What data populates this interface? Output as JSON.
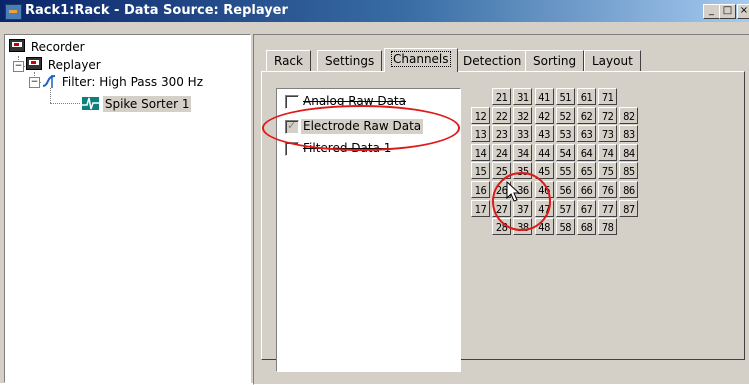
{
  "window": {
    "title": "Rack1:Rack - Data Source: Replayer",
    "buttons": [
      "minimize",
      "maximize",
      "close"
    ]
  },
  "tree": {
    "nodes": [
      {
        "label": "Recorder",
        "icon": "recorder-icon"
      },
      {
        "label": "Replayer",
        "icon": "recorder-icon",
        "expander": "−"
      },
      {
        "label": "Filter: High Pass 300 Hz",
        "icon": "filter-icon",
        "expander": "−"
      },
      {
        "label": "Spike Sorter 1",
        "icon": "spike-sorter-icon",
        "selected": true
      }
    ]
  },
  "tabs": [
    "Rack",
    "Settings",
    "Channels",
    "Detection",
    "Sorting",
    "Layout"
  ],
  "active_tab": "Channels",
  "channels_list": [
    {
      "label": "Analog Raw Data",
      "checked": false
    },
    {
      "label": "Electrode Raw Data",
      "checked": true,
      "selected": true
    },
    {
      "label": "Filtered Data 1",
      "checked": false
    }
  ],
  "channel_grid": [
    [
      "",
      "21",
      "31",
      "41",
      "51",
      "61",
      "71",
      ""
    ],
    [
      "12",
      "22",
      "32",
      "42",
      "52",
      "62",
      "72",
      "82"
    ],
    [
      "13",
      "23",
      "33",
      "43",
      "53",
      "63",
      "73",
      "83"
    ],
    [
      "14",
      "24",
      "34",
      "44",
      "54",
      "64",
      "74",
      "84"
    ],
    [
      "15",
      "25",
      "35",
      "45",
      "55",
      "65",
      "75",
      "85"
    ],
    [
      "16",
      "26",
      "36",
      "46",
      "56",
      "66",
      "76",
      "86"
    ],
    [
      "17",
      "27",
      "37",
      "47",
      "57",
      "67",
      "77",
      "87"
    ],
    [
      "",
      "28",
      "38",
      "48",
      "58",
      "68",
      "78",
      ""
    ]
  ],
  "colors": {
    "annotation": "#e01818",
    "title_start": "#0a246a",
    "title_end": "#a6caf0",
    "face": "#d4d0c8"
  }
}
